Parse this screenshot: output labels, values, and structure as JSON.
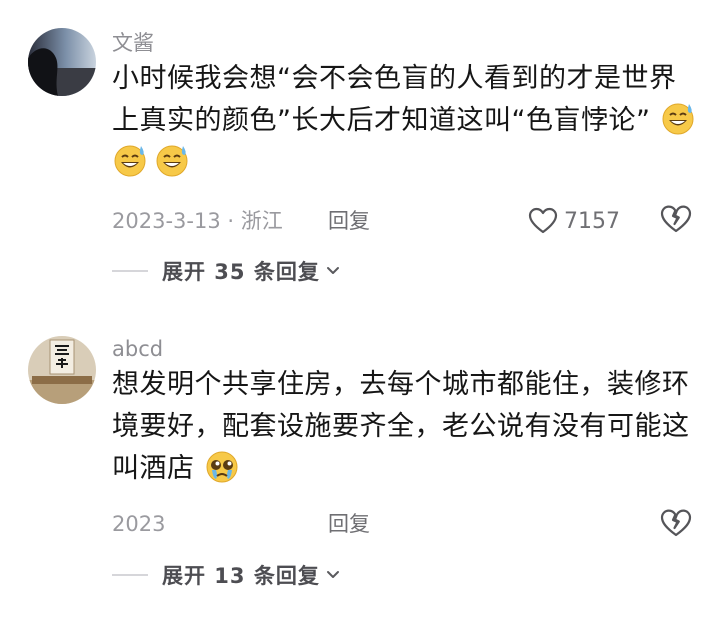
{
  "comments": [
    {
      "username": "文酱",
      "content_lines": [
        "小时候我会想“会不会色盲的人看到的才是世界",
        "上真实的颜色”长大后才知道这叫“色盲悖论”"
      ],
      "emojis": [
        "sweat-smile-emoji",
        "sweat-smile-emoji",
        "sweat-smile-emoji"
      ],
      "time_location": "2023-3-13 · 浙江",
      "reply_label": "回复",
      "like_count": "7157",
      "expand_label": "展开 35 条回复"
    },
    {
      "username": "abcd",
      "content_lines": [
        "想发明个共享住房，去每个城市都能住，装修环",
        "境要好，配套设施要齐全，老公说有没有可能这",
        "叫酒店"
      ],
      "emojis": [
        "pleading-face-emoji"
      ],
      "time_location": "2023",
      "reply_label": "回复",
      "expand_label": "展开 13 条回复"
    }
  ],
  "icons": {
    "like": "heart-outline-icon",
    "dislike": "broken-heart-icon",
    "expand": "chevron-down-icon"
  },
  "colors": {
    "text": "#161616",
    "meta": "#9a9a9f",
    "emoji_yellow": "#f7c948",
    "emoji_blue": "#6ab7e8"
  }
}
